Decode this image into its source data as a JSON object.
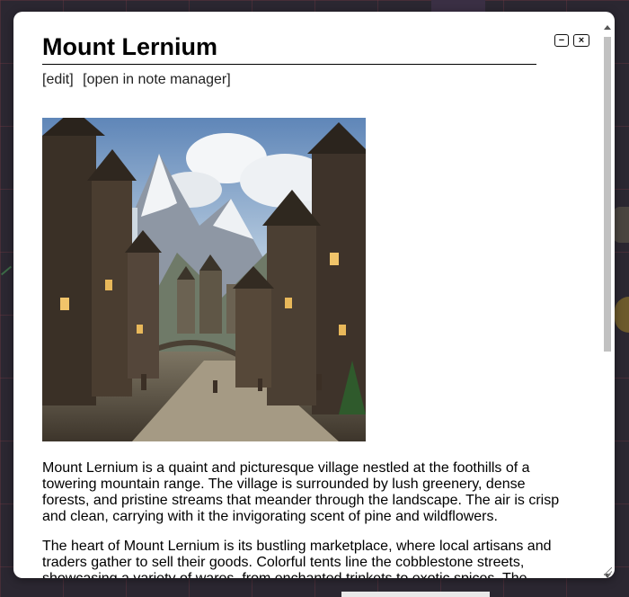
{
  "note": {
    "title": "Mount Lernium",
    "links": [
      "[edit]",
      "[open in note manager]"
    ],
    "paragraphs": [
      "Mount Lernium is a quaint and picturesque village nestled at the foothills of a towering mountain range. The village is surrounded by lush greenery, dense forests, and pristine streams that meander through the landscape. The air is crisp and clean, carrying with it the invigorating scent of pine and wildflowers.",
      "The heart of Mount Lernium is its bustling marketplace, where local artisans and traders gather to sell their goods. Colorful tents line the cobblestone streets, showcasing a variety of wares, from enchanted trinkets to exotic spices. The"
    ]
  },
  "window_controls": {
    "minimize_symbol": "−",
    "close_symbol": "×"
  },
  "icons": [
    "minimize-icon",
    "close-icon",
    "scroll-up-icon",
    "scroll-down-icon",
    "resize-grip-icon"
  ],
  "colors": {
    "dialog_bg": "#ffffff",
    "page_bg": "#2b2731",
    "text": "#000000"
  }
}
